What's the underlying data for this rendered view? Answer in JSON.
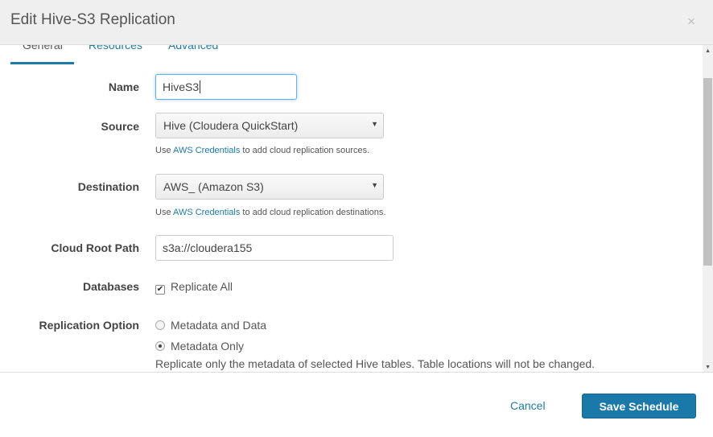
{
  "dialog": {
    "title": "Edit Hive-S3 Replication",
    "close_icon": "×"
  },
  "tabs": [
    "General",
    "Resources",
    "Advanced"
  ],
  "form": {
    "name": {
      "label": "Name",
      "value": "HiveS3"
    },
    "source": {
      "label": "Source",
      "value": "Hive (Cloudera QuickStart)",
      "help_prefix": "Use",
      "help_link": "AWS Credentials",
      "help_suffix": "to add cloud replication sources."
    },
    "destination": {
      "label": "Destination",
      "value": "AWS_ (Amazon S3)",
      "help_prefix": "Use",
      "help_link": "AWS Credentials",
      "help_suffix": "to add cloud replication destinations."
    },
    "cloud_root_path": {
      "label": "Cloud Root Path",
      "value": "s3a://cloudera155"
    },
    "databases": {
      "label": "Databases",
      "option": "Replicate All",
      "checked": true
    },
    "replication_option": {
      "label": "Replication Option",
      "options": [
        "Metadata and Data",
        "Metadata Only"
      ],
      "selected": "Metadata Only",
      "help": "Replicate only the metadata of selected Hive tables. Table locations will not be changed."
    }
  },
  "footer": {
    "cancel": "Cancel",
    "save": "Save Schedule"
  }
}
